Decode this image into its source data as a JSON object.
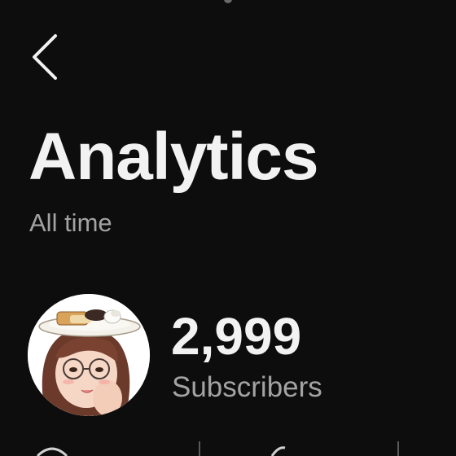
{
  "header": {
    "back_icon": "chevron-left-icon"
  },
  "page": {
    "title": "Analytics",
    "subtitle": "All time"
  },
  "channel": {
    "avatar_icon": "channel-avatar",
    "subscriber_count": "2,999",
    "subscriber_label": "Subscribers"
  },
  "stats_row": {
    "icons": [
      "views-icon",
      "likes-icon"
    ]
  },
  "colors": {
    "background": "#0d0d0d",
    "primary_text": "#f2f2f2",
    "secondary_text": "#a3a3a3",
    "divider": "#5a5a5a"
  }
}
